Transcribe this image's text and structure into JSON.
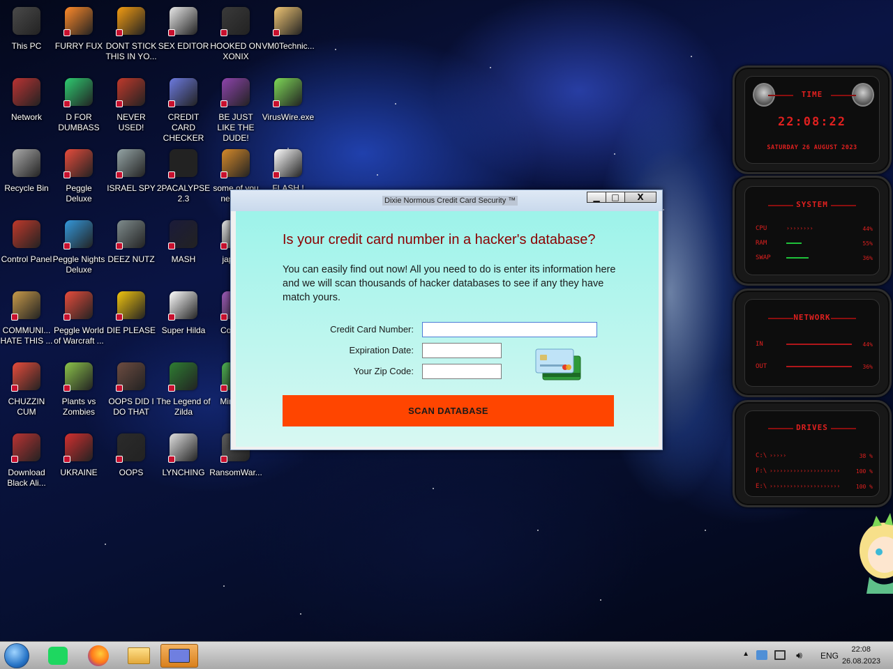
{
  "desktop": {
    "icons": [
      {
        "label": "This PC"
      },
      {
        "label": "FURRY FUX"
      },
      {
        "label": "DONT STICK THIS IN YO..."
      },
      {
        "label": "SEX EDITOR"
      },
      {
        "label": "HOOKED ON XONIX"
      },
      {
        "label": "VM0Technic..."
      },
      {
        "label": "Network"
      },
      {
        "label": "D FOR DUMBASS"
      },
      {
        "label": "NEVER USED!"
      },
      {
        "label": "CREDIT CARD CHECKER"
      },
      {
        "label": "BE JUST LIKE THE DUDE!"
      },
      {
        "label": "VirusWire.exe"
      },
      {
        "label": "Recycle Bin"
      },
      {
        "label": "Peggle Deluxe"
      },
      {
        "label": "ISRAEL SPY"
      },
      {
        "label": "2PACALYPSE 2.3"
      },
      {
        "label": "some of you need t..."
      },
      {
        "label": "FLASH !"
      },
      {
        "label": "Control Panel"
      },
      {
        "label": "Peggle Nights Deluxe"
      },
      {
        "label": "DEEZ NUTZ"
      },
      {
        "label": "MASH"
      },
      {
        "label": "japan..."
      },
      {
        "label": "COMMUNI... HATE THIS ..."
      },
      {
        "label": "Peggle World of Warcraft ..."
      },
      {
        "label": "DIE PLEASE"
      },
      {
        "label": "Super Hilda"
      },
      {
        "label": "Collab..."
      },
      {
        "label": "CHUZZIN CUM"
      },
      {
        "label": "Plants vs Zombies"
      },
      {
        "label": "OOPS DID I DO THAT"
      },
      {
        "label": "The Legend of Zilda"
      },
      {
        "label": "Minecr..."
      },
      {
        "label": "Download Black Ali..."
      },
      {
        "label": "UKRAINE"
      },
      {
        "label": "OOPS"
      },
      {
        "label": "LYNCHING"
      },
      {
        "label": "RansomWar..."
      }
    ]
  },
  "window": {
    "title": "Dixie Normous Credit Card Security ™",
    "minimize": "▁",
    "maximize": "□",
    "close": "X",
    "heading": "Is your credit card number in a hacker's database?",
    "description": "You can easily find out now! All you need to do is enter its information here and we will scan thousands of hacker databases to see if any they have match yours.",
    "card_number_label": "Credit Card Number:",
    "card_number_value": "",
    "expiration_label": "Expiration Date:",
    "expiration_value": "",
    "zip_label": "Your Zip Code:",
    "zip_value": "",
    "scan_button": "SCAN DATABASE",
    "colors": {
      "accent": "#ff4500",
      "heading": "#8b0000",
      "background": "#c8f6f0"
    }
  },
  "gadget": {
    "time_title": "TIME",
    "time": "22:08:22",
    "date": "SATURDAY 26 AUGUST 2023",
    "system_title": "SYSTEM",
    "system_rows": [
      {
        "label": "CPU",
        "pct": "44%"
      },
      {
        "label": "RAM",
        "pct": "55%"
      },
      {
        "label": "SWAP",
        "pct": "36%"
      }
    ],
    "network_title": "NETWORK",
    "network_rows": [
      {
        "label": "IN",
        "pct": "44%"
      },
      {
        "label": "OUT",
        "pct": "36%"
      }
    ],
    "drives_title": "DRIVES",
    "drive_rows": [
      {
        "label": "C:\\",
        "pct": "38 %"
      },
      {
        "label": "F:\\",
        "pct": "100 %"
      },
      {
        "label": "E:\\",
        "pct": "100 %"
      }
    ]
  },
  "taskbar": {
    "language": "ENG",
    "time": "22:08",
    "date": "26.08.2023"
  }
}
